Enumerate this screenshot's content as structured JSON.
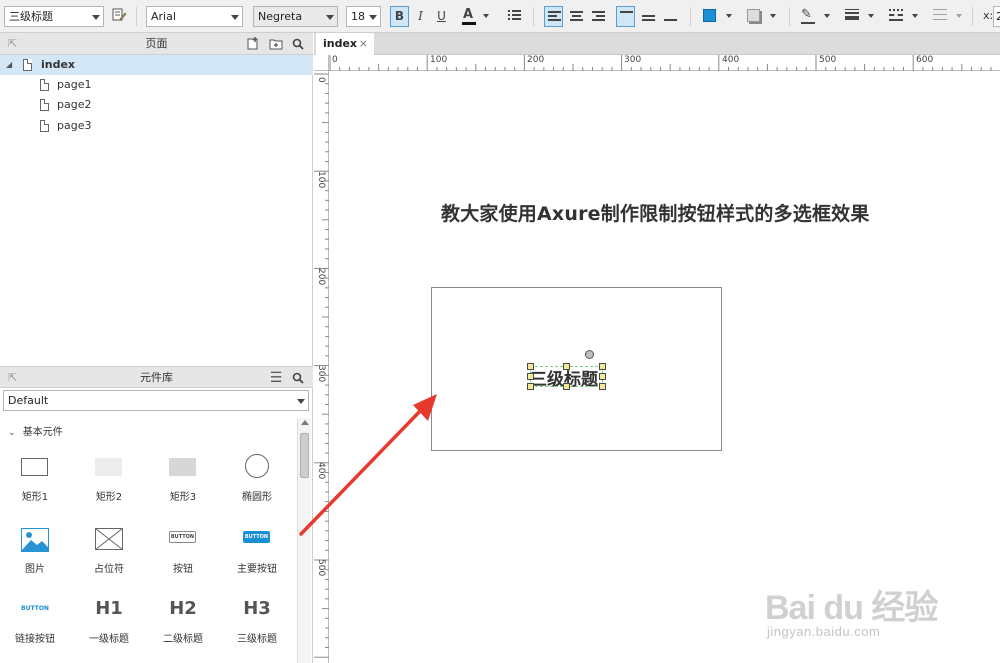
{
  "toolbar": {
    "style_select": "三级标题",
    "font_family": "Arial",
    "font_weight": "Negreta",
    "font_size": "18",
    "bold": "B",
    "italic": "I",
    "underline": "U",
    "font_color_glyph": "A",
    "x_label": "x:",
    "x_value": "2",
    "colors": {
      "fill": "#1a8fd6",
      "font_underline": "#111111",
      "active": "#cfe6f7"
    }
  },
  "pages_panel": {
    "title": "页面",
    "items": [
      {
        "label": "index",
        "selected": true
      },
      {
        "label": "page1"
      },
      {
        "label": "page2"
      },
      {
        "label": "page3"
      }
    ]
  },
  "library_panel": {
    "title": "元件库",
    "library_select": "Default",
    "section": "基本元件",
    "widgets": [
      {
        "label": "矩形1",
        "icon": "rectangle-outline-icon"
      },
      {
        "label": "矩形2",
        "icon": "rectangle-light-icon"
      },
      {
        "label": "矩形3",
        "icon": "rectangle-grey-icon"
      },
      {
        "label": "椭圆形",
        "icon": "ellipse-icon"
      },
      {
        "label": "图片",
        "icon": "image-icon"
      },
      {
        "label": "占位符",
        "icon": "placeholder-icon"
      },
      {
        "label": "按钮",
        "icon": "button-icon",
        "icon_text": "BUTTON"
      },
      {
        "label": "主要按钮",
        "icon": "primary-button-icon",
        "icon_text": "BUTTON"
      },
      {
        "label": "链接按钮",
        "icon": "link-button-icon",
        "icon_text": "BUTTON"
      },
      {
        "label": "一级标题",
        "icon": "h1-icon",
        "icon_text": "H1"
      },
      {
        "label": "二级标题",
        "icon": "h2-icon",
        "icon_text": "H2"
      },
      {
        "label": "三级标题",
        "icon": "h3-icon",
        "icon_text": "H3"
      }
    ]
  },
  "canvas": {
    "tab_label": "index",
    "tab_close": "×",
    "ruler_h": [
      "0",
      "100",
      "200",
      "300",
      "400",
      "500",
      "600"
    ],
    "ruler_v": [
      "0",
      "100",
      "200",
      "300",
      "400",
      "500"
    ],
    "heading_text": "教大家使用Axure制作限制按钮样式的多选框效果",
    "selected_widget_text": "三级标题",
    "annotation_arrow_color": "#e8392f"
  },
  "watermark": {
    "brand": "Bai du 经验",
    "url": "jingyan.baidu.com"
  }
}
